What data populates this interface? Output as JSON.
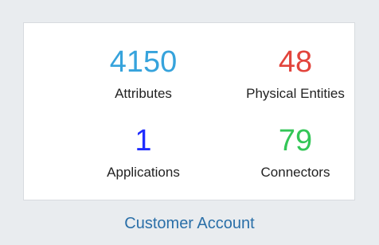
{
  "stats": [
    {
      "value": "4150",
      "label": "Attributes",
      "color": "#36a3dc"
    },
    {
      "value": "48",
      "label": "Physical Entities",
      "color": "#e2443c"
    },
    {
      "value": "1",
      "label": "Applications",
      "color": "#1f2cff"
    },
    {
      "value": "79",
      "label": "Connectors",
      "color": "#33c657"
    }
  ],
  "footer": {
    "title": "Customer Account"
  }
}
